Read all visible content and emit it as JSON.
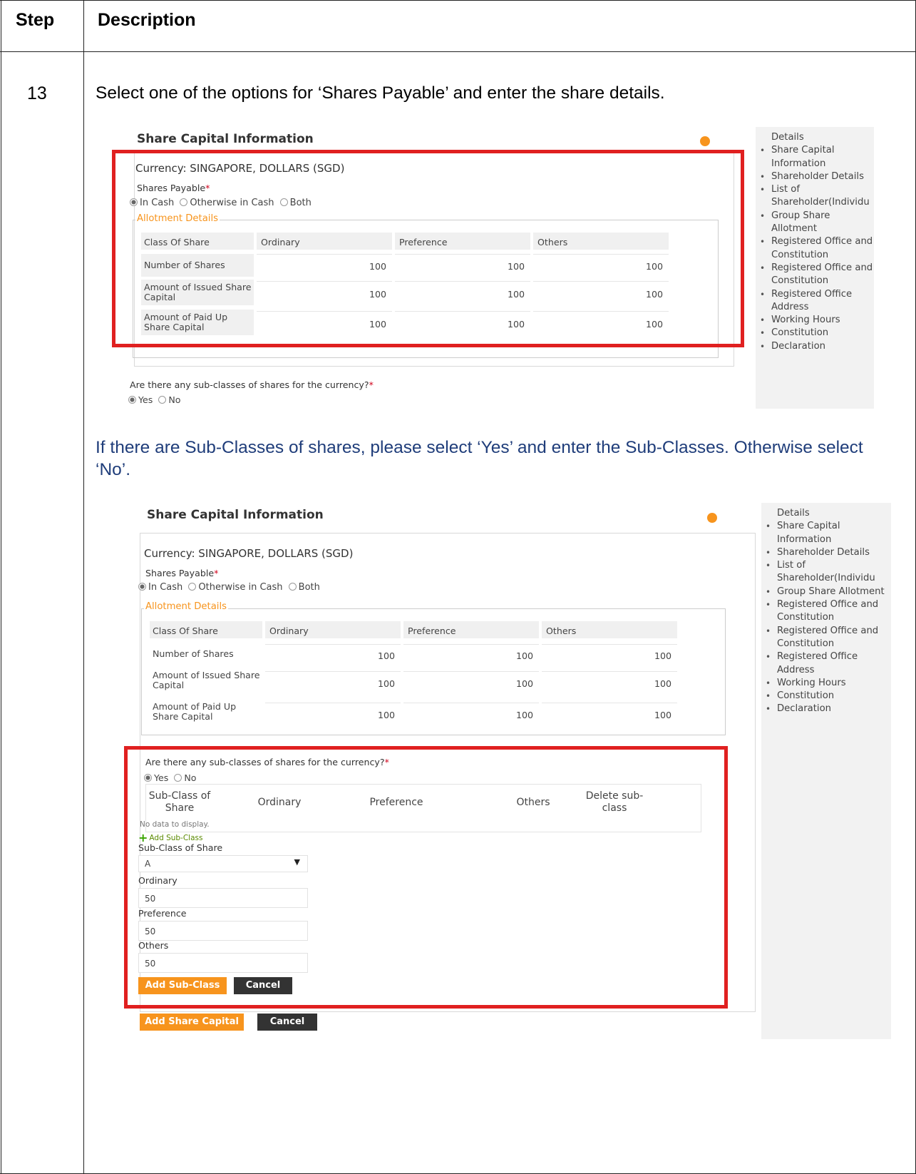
{
  "table": {
    "header_step": "Step",
    "header_description": "Description",
    "step_number": "13",
    "instruction_1": "Select one of the options for ‘Shares Payable’ and enter the share details.",
    "instruction_2": "If there are Sub-Classes of shares, please select ‘Yes’ and enter the Sub-Classes. Otherwise select ‘No’."
  },
  "panel": {
    "title": "Share Capital Information",
    "currency": "Currency: SINGAPORE, DOLLARS (SGD)",
    "shares_payable_label": "Shares Payable",
    "required_mark": "*",
    "options": [
      "In Cash",
      "Otherwise in Cash",
      "Both"
    ],
    "selected_option": "In Cash",
    "allotment_legend": "Allotment Details",
    "columns": [
      "Class Of Share",
      "Ordinary",
      "Preference",
      "Others"
    ],
    "rows": [
      {
        "label": "Number of Shares",
        "values": [
          "100",
          "100",
          "100"
        ]
      },
      {
        "label": "Amount of Issued Share Capital",
        "values": [
          "100",
          "100",
          "100"
        ]
      },
      {
        "label": "Amount of Paid Up Share Capital",
        "values": [
          "100",
          "100",
          "100"
        ]
      }
    ],
    "subclass_question": "Are there any sub-classes of shares for the currency?",
    "yes_label": "Yes",
    "no_label": "No"
  },
  "sidebar": {
    "items": [
      {
        "label": "Details",
        "bullet": false
      },
      {
        "label": "Share Capital Information",
        "bullet": true
      },
      {
        "label": "Shareholder Details",
        "bullet": true
      },
      {
        "label": "List of Shareholder(Individu",
        "bullet": true
      },
      {
        "label": "Group Share Allotment",
        "bullet": true
      },
      {
        "label": "Registered Office and Constitution",
        "bullet": true
      },
      {
        "label": "Registered Office and Constitution",
        "bullet": true
      },
      {
        "label": "Registered Office Address",
        "bullet": true
      },
      {
        "label": "Working Hours",
        "bullet": true
      },
      {
        "label": "Constitution",
        "bullet": true
      },
      {
        "label": "Declaration",
        "bullet": true
      }
    ]
  },
  "subclass": {
    "table_headers": [
      "Sub-Class of Share",
      "Ordinary",
      "Preference",
      "Others",
      "Delete sub-class"
    ],
    "no_data": "No data to display.",
    "add_link": "Add Sub-Class",
    "subclass_label": "Sub-Class of Share",
    "subclass_value": "A",
    "ordinary_label": "Ordinary",
    "ordinary_value": "50",
    "preference_label": "Preference",
    "preference_value": "50",
    "others_label": "Others",
    "others_value": "50",
    "add_button": "Add Sub-Class",
    "cancel_button": "Cancel"
  },
  "footer_buttons": {
    "add_share_capital": "Add Share Capital",
    "cancel": "Cancel"
  },
  "colors": {
    "highlight_red": "#e02020",
    "accent_orange": "#f7941d",
    "instruction_blue": "#1f3d7a"
  }
}
